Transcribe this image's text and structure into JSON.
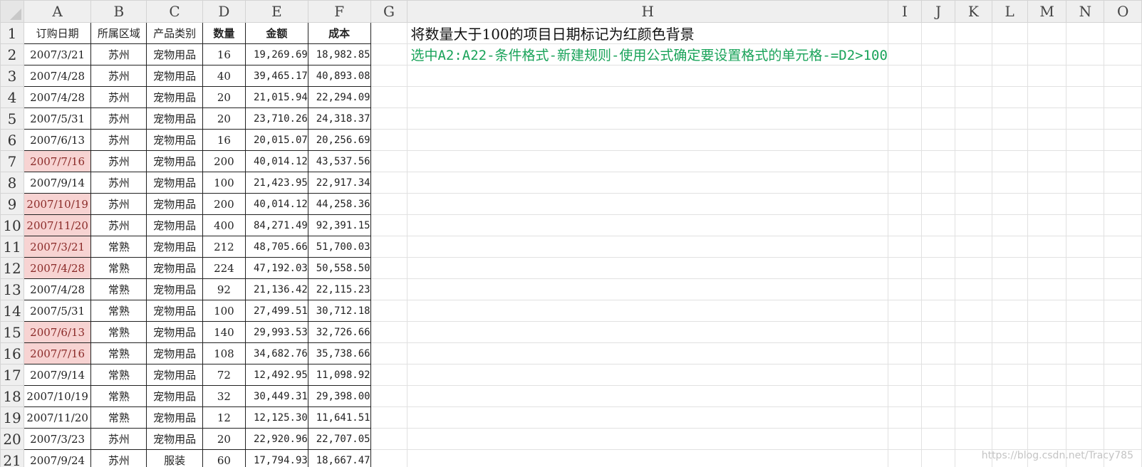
{
  "columns": [
    "A",
    "B",
    "C",
    "D",
    "E",
    "F",
    "G",
    "H",
    "I",
    "J",
    "K",
    "L",
    "M",
    "N",
    "O"
  ],
  "rows": [
    "1",
    "2",
    "3",
    "4",
    "5",
    "6",
    "7",
    "8",
    "9",
    "10",
    "11",
    "12",
    "13",
    "14",
    "15",
    "16",
    "17",
    "18",
    "19",
    "20",
    "21"
  ],
  "headers": [
    "订购日期",
    "所属区域",
    "产品类别",
    "数量",
    "金额",
    "成本"
  ],
  "records": [
    {
      "date": "2007/3/21",
      "region": "苏州",
      "category": "宠物用品",
      "qty": "16",
      "amount": "19,269.69",
      "cost": "18,982.85"
    },
    {
      "date": "2007/4/28",
      "region": "苏州",
      "category": "宠物用品",
      "qty": "40",
      "amount": "39,465.17",
      "cost": "40,893.08"
    },
    {
      "date": "2007/4/28",
      "region": "苏州",
      "category": "宠物用品",
      "qty": "20",
      "amount": "21,015.94",
      "cost": "22,294.09"
    },
    {
      "date": "2007/5/31",
      "region": "苏州",
      "category": "宠物用品",
      "qty": "20",
      "amount": "23,710.26",
      "cost": "24,318.37"
    },
    {
      "date": "2007/6/13",
      "region": "苏州",
      "category": "宠物用品",
      "qty": "16",
      "amount": "20,015.07",
      "cost": "20,256.69"
    },
    {
      "date": "2007/7/16",
      "region": "苏州",
      "category": "宠物用品",
      "qty": "200",
      "amount": "40,014.12",
      "cost": "43,537.56"
    },
    {
      "date": "2007/9/14",
      "region": "苏州",
      "category": "宠物用品",
      "qty": "100",
      "amount": "21,423.95",
      "cost": "22,917.34"
    },
    {
      "date": "2007/10/19",
      "region": "苏州",
      "category": "宠物用品",
      "qty": "200",
      "amount": "40,014.12",
      "cost": "44,258.36"
    },
    {
      "date": "2007/11/20",
      "region": "苏州",
      "category": "宠物用品",
      "qty": "400",
      "amount": "84,271.49",
      "cost": "92,391.15"
    },
    {
      "date": "2007/3/21",
      "region": "常熟",
      "category": "宠物用品",
      "qty": "212",
      "amount": "48,705.66",
      "cost": "51,700.03"
    },
    {
      "date": "2007/4/28",
      "region": "常熟",
      "category": "宠物用品",
      "qty": "224",
      "amount": "47,192.03",
      "cost": "50,558.50"
    },
    {
      "date": "2007/4/28",
      "region": "常熟",
      "category": "宠物用品",
      "qty": "92",
      "amount": "21,136.42",
      "cost": "22,115.23"
    },
    {
      "date": "2007/5/31",
      "region": "常熟",
      "category": "宠物用品",
      "qty": "100",
      "amount": "27,499.51",
      "cost": "30,712.18"
    },
    {
      "date": "2007/6/13",
      "region": "常熟",
      "category": "宠物用品",
      "qty": "140",
      "amount": "29,993.53",
      "cost": "32,726.66"
    },
    {
      "date": "2007/7/16",
      "region": "常熟",
      "category": "宠物用品",
      "qty": "108",
      "amount": "34,682.76",
      "cost": "35,738.66"
    },
    {
      "date": "2007/9/14",
      "region": "常熟",
      "category": "宠物用品",
      "qty": "72",
      "amount": "12,492.95",
      "cost": "11,098.92"
    },
    {
      "date": "2007/10/19",
      "region": "常熟",
      "category": "宠物用品",
      "qty": "32",
      "amount": "30,449.31",
      "cost": "29,398.00"
    },
    {
      "date": "2007/11/20",
      "region": "常熟",
      "category": "宠物用品",
      "qty": "12",
      "amount": "12,125.30",
      "cost": "11,641.51"
    },
    {
      "date": "2007/3/23",
      "region": "苏州",
      "category": "宠物用品",
      "qty": "20",
      "amount": "22,920.96",
      "cost": "22,707.05"
    },
    {
      "date": "2007/9/24",
      "region": "苏州",
      "category": "服装",
      "qty": "60",
      "amount": "17,794.93",
      "cost": "18,667.47"
    }
  ],
  "highlighted_rows": [
    7,
    9,
    10,
    11,
    12,
    15,
    16
  ],
  "highlight_color": "#f7d3d2",
  "note_title": "将数量大于100的项目日期标记为红颜色背景",
  "note_steps": "选中A2:A22-条件格式-新建规则-使用公式确定要设置格式的单元格-=D2>100",
  "note_steps_color": "#1aa35a",
  "watermark": "https://blog.csdn.net/Tracy785"
}
